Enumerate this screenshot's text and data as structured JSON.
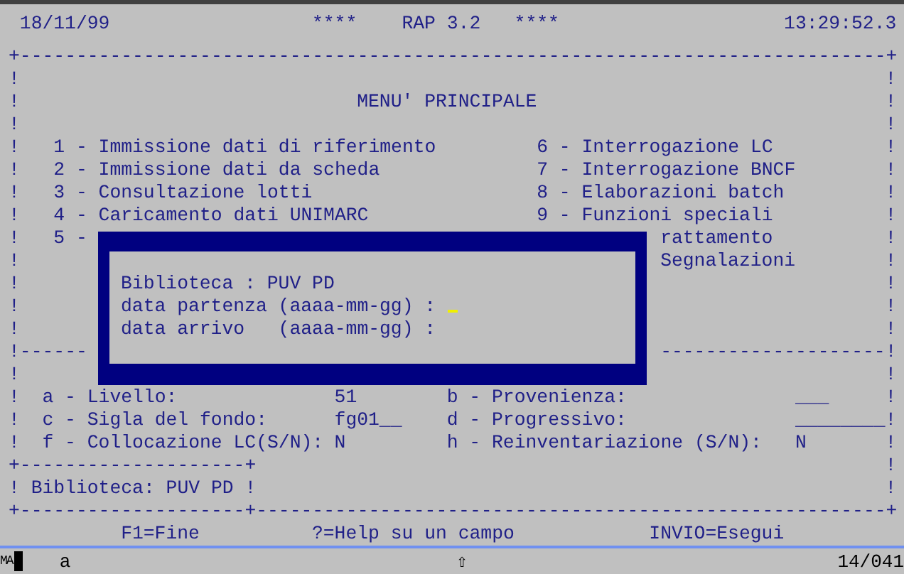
{
  "header": {
    "date": "18/11/99",
    "title": [
      "****",
      "RAP 3.2",
      "****"
    ],
    "time": "13:29:52.3"
  },
  "frame": {
    "corner": "+",
    "horizontal": "-",
    "vertical": "!"
  },
  "menu": {
    "title": "MENU' PRINCIPALE",
    "left": [
      "1 - Immissione dati di riferimento",
      "2 - Immissione dati da scheda",
      "3 - Consultazione lotti",
      "4 - Caricamento dati UNIMARC",
      "5 -"
    ],
    "right": [
      "6 - Interrogazione LC",
      "7 - Interrogazione BNCF",
      "8 - Elaborazioni batch",
      "9 - Funzioni speciali",
      "rattamento",
      "Segnalazioni"
    ]
  },
  "dialog": {
    "library": "Biblioteca : PUV PD",
    "fields": [
      {
        "label": "data partenza (aaaa-mm-gg) :",
        "focused": true
      },
      {
        "label": "data arrivo   (aaaa-mm-gg) :",
        "focused": false
      }
    ]
  },
  "parameters": [
    {
      "label": "a - Livello:",
      "value": "51"
    },
    {
      "label": "b - Provenienza:",
      "value": "___"
    },
    {
      "label": "c - Sigla del fondo:",
      "value": "fg01__"
    },
    {
      "label": "d - Progressivo:",
      "value": "________"
    },
    {
      "label": "f - Collocazione LC(S/N):",
      "value": "N"
    },
    {
      "label": "h - Reinventariazione (S/N):",
      "value": "N"
    }
  ],
  "library_box": "Biblioteca: PUV PD",
  "keys": [
    "F1=Fine",
    "?=Help su un campo",
    "INVIO=Esegui"
  ],
  "status_bar": {
    "mode": "MA",
    "input": "a",
    "shift": "⇧",
    "position": "14/041"
  }
}
